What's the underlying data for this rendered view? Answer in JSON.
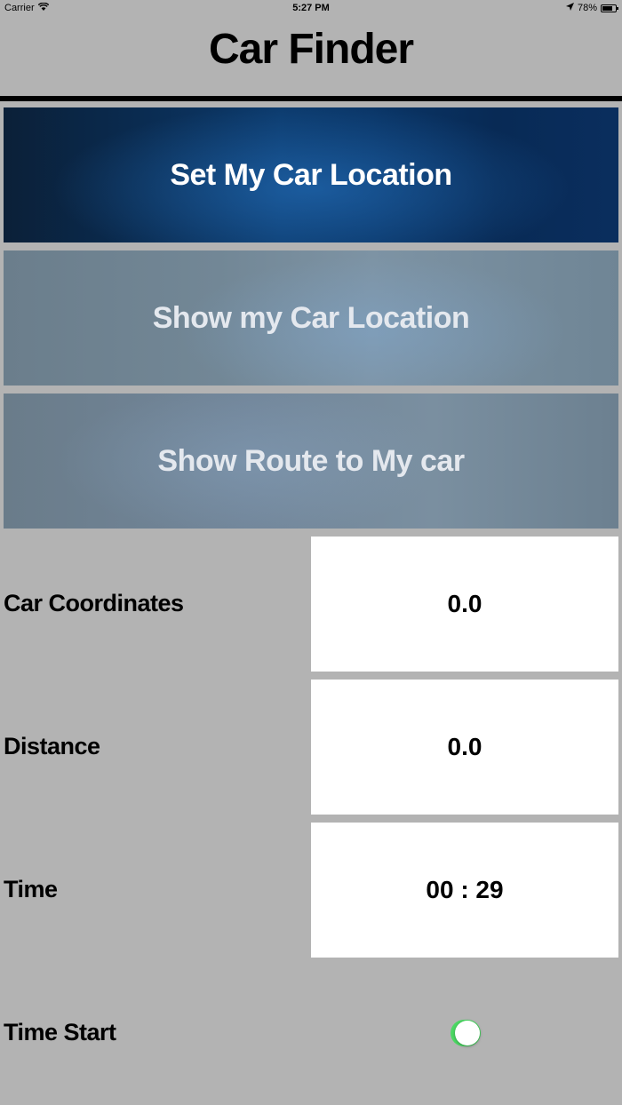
{
  "status_bar": {
    "carrier": "Carrier",
    "time": "5:27 PM",
    "battery": "78%",
    "battery_level": 0.78
  },
  "header": {
    "title": "Car Finder"
  },
  "buttons": {
    "set_location": "Set My Car Location",
    "show_location": "Show my Car Location",
    "show_route": "Show Route to My car"
  },
  "info": {
    "coordinates_label": "Car Coordinates",
    "coordinates_value": "0.0",
    "distance_label": "Distance",
    "distance_value": "0.0",
    "time_label": "Time",
    "time_value": "00 : 29",
    "time_start_label": "Time Start",
    "time_start_on": true
  },
  "colors": {
    "toggle_on": "#4cd964",
    "background": "#b3b3b3"
  }
}
